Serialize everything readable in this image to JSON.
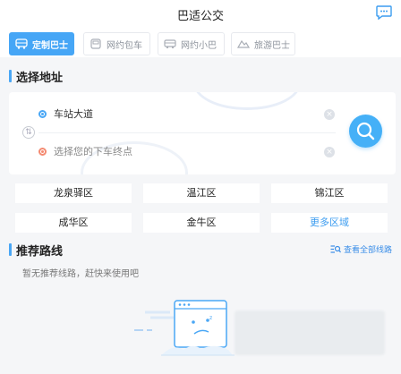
{
  "header": {
    "title": "巴适公交"
  },
  "tabs": [
    {
      "label": "定制巴士",
      "active": true,
      "icon": "bus-icon"
    },
    {
      "label": "网约包车",
      "active": false,
      "icon": "car-icon"
    },
    {
      "label": "网约小巴",
      "active": false,
      "icon": "minibus-icon"
    },
    {
      "label": "旅游巴士",
      "active": false,
      "icon": "mountain-icon"
    }
  ],
  "address": {
    "section_title": "选择地址",
    "start_value": "车站大道",
    "end_placeholder": "选择您的下车终点"
  },
  "districts": [
    "龙泉驿区",
    "温江区",
    "锦江区",
    "成华区",
    "金牛区",
    "更多区域"
  ],
  "routes": {
    "section_title": "推荐路线",
    "view_all": "查看全部线路",
    "empty_text": "暂无推荐线路，赶快来使用吧"
  },
  "colors": {
    "accent": "#46a6f6",
    "end_dot": "#f48a71",
    "bg": "#f5f6f8"
  }
}
